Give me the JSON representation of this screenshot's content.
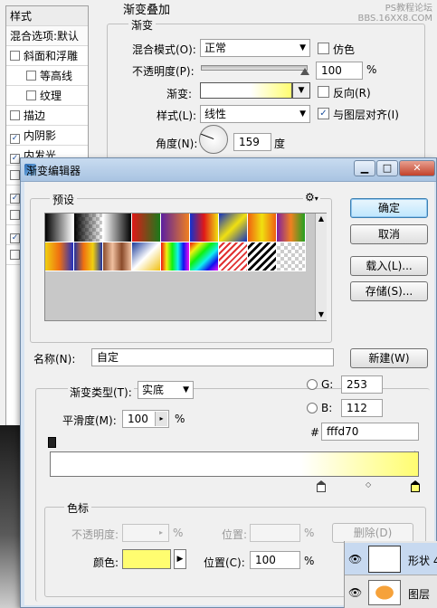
{
  "layer_style": {
    "styles_header": "样式",
    "blend_options": "混合选项:默认",
    "items": [
      {
        "label": "斜面和浮雕",
        "checked": false,
        "indent": false
      },
      {
        "label": "等高线",
        "checked": false,
        "indent": true
      },
      {
        "label": "纹理",
        "checked": false,
        "indent": true
      },
      {
        "label": "描边",
        "checked": false,
        "indent": false
      },
      {
        "label": "内阴影",
        "checked": true,
        "indent": false
      },
      {
        "label": "内发光",
        "checked": true,
        "indent": false
      }
    ],
    "section_title": "渐变叠加",
    "sub_title": "渐变",
    "blend_mode_label": "混合模式(O):",
    "blend_mode_value": "正常",
    "dither_label": "仿色",
    "opacity_label": "不透明度(P):",
    "opacity_value": "100",
    "opacity_unit": "%",
    "gradient_label": "渐变:",
    "reverse_label": "反向(R)",
    "style_label": "样式(L):",
    "style_value": "线性",
    "align_label": "与图层对齐(I)",
    "angle_label": "角度(N):",
    "angle_value": "159",
    "angle_unit": "度",
    "watermark": "PS教程论坛\nBBS.16XX8.COM"
  },
  "editor": {
    "title": "渐变编辑器",
    "presets_label": "预设",
    "ok": "确定",
    "cancel": "取消",
    "load": "载入(L)...",
    "save": "存储(S)...",
    "name_label": "名称(N):",
    "name_value": "自定",
    "new_button": "新建(W)",
    "gradient_type_label": "渐变类型(T):",
    "gradient_type_value": "实底",
    "smoothness_label": "平滑度(M):",
    "smoothness_value": "100",
    "smoothness_unit": "%",
    "g_label": "G:",
    "g_value": "253",
    "b_label": "B:",
    "b_value": "112",
    "hex_label": "#",
    "hex_value": "fffd70",
    "stops_label": "色标",
    "stop_opacity_label": "不透明度:",
    "stop_opacity_unit": "%",
    "location_label_disabled": "位置:",
    "location_unit_disabled": "%",
    "delete_button": "删除(D)",
    "color_label": "颜色:",
    "color_value": "#fffd70",
    "location_label": "位置(C):",
    "location_value": "100",
    "location_unit": "%",
    "gradient_colors": [
      "#ffffff",
      "#fffd70"
    ]
  },
  "layers": {
    "row1_label": "形状 4",
    "row2_label": "图层"
  }
}
